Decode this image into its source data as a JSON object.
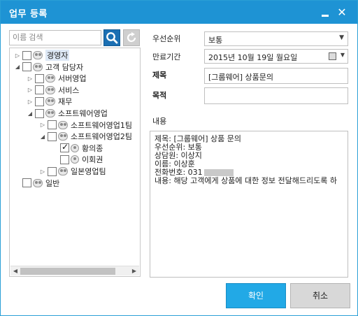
{
  "window": {
    "title": "업무 등록",
    "minimize_icon": "minimize-icon",
    "close_icon": "close-icon"
  },
  "search": {
    "placeholder": "이름 검색",
    "search_icon": "search-icon",
    "refresh_icon": "refresh-icon"
  },
  "tree": {
    "nodes": [
      {
        "label": "경영자",
        "type": "group",
        "expander": "▷",
        "checked": false
      },
      {
        "label": "고객 담당자",
        "type": "group",
        "expander": "◢",
        "checked": false
      },
      {
        "label": "서버영업",
        "type": "group",
        "expander": "▷",
        "checked": false
      },
      {
        "label": "서비스",
        "type": "group",
        "expander": "▷",
        "checked": false
      },
      {
        "label": "재무",
        "type": "group",
        "expander": "▷",
        "checked": false
      },
      {
        "label": "소프트웨어영업",
        "type": "group",
        "expander": "◢",
        "checked": false
      },
      {
        "label": "소프트웨어영업1팀",
        "type": "group",
        "expander": "▷",
        "checked": false
      },
      {
        "label": "소프트웨어영업2팀",
        "type": "group",
        "expander": "◢",
        "checked": false
      },
      {
        "label": "황의종",
        "type": "user",
        "expander": "",
        "checked": true
      },
      {
        "label": "이회권",
        "type": "user",
        "expander": "",
        "checked": false
      },
      {
        "label": "일본영업팀",
        "type": "group",
        "expander": "▷",
        "checked": false
      },
      {
        "label": "일반",
        "type": "group",
        "expander": "",
        "checked": false
      }
    ]
  },
  "form": {
    "priority_label": "우선순위",
    "priority_value": "보통",
    "due_label": "만료기간",
    "due_value": "2015년 10월 19일 월요일",
    "subject_label": "제목",
    "subject_value": "[그룹웨어] 상품문의",
    "purpose_label": "목적",
    "purpose_value": "",
    "content_label": "내용",
    "content_lines": [
      "제목: [그룹웨어] 상품 문의",
      "우선순위: 보통",
      "상담원: 이상지",
      "이름: 이상훈",
      "전화번호: 031",
      "내용: 해당 고객에게 상품에 대한 정보 전달해드리도록 하"
    ]
  },
  "buttons": {
    "ok": "확인",
    "cancel": "취소"
  },
  "colors": {
    "titlebar": "#1e93d4",
    "ok_button": "#22a9e6",
    "cancel_button": "#d8d8d8",
    "search_button": "#1b6fb3"
  }
}
